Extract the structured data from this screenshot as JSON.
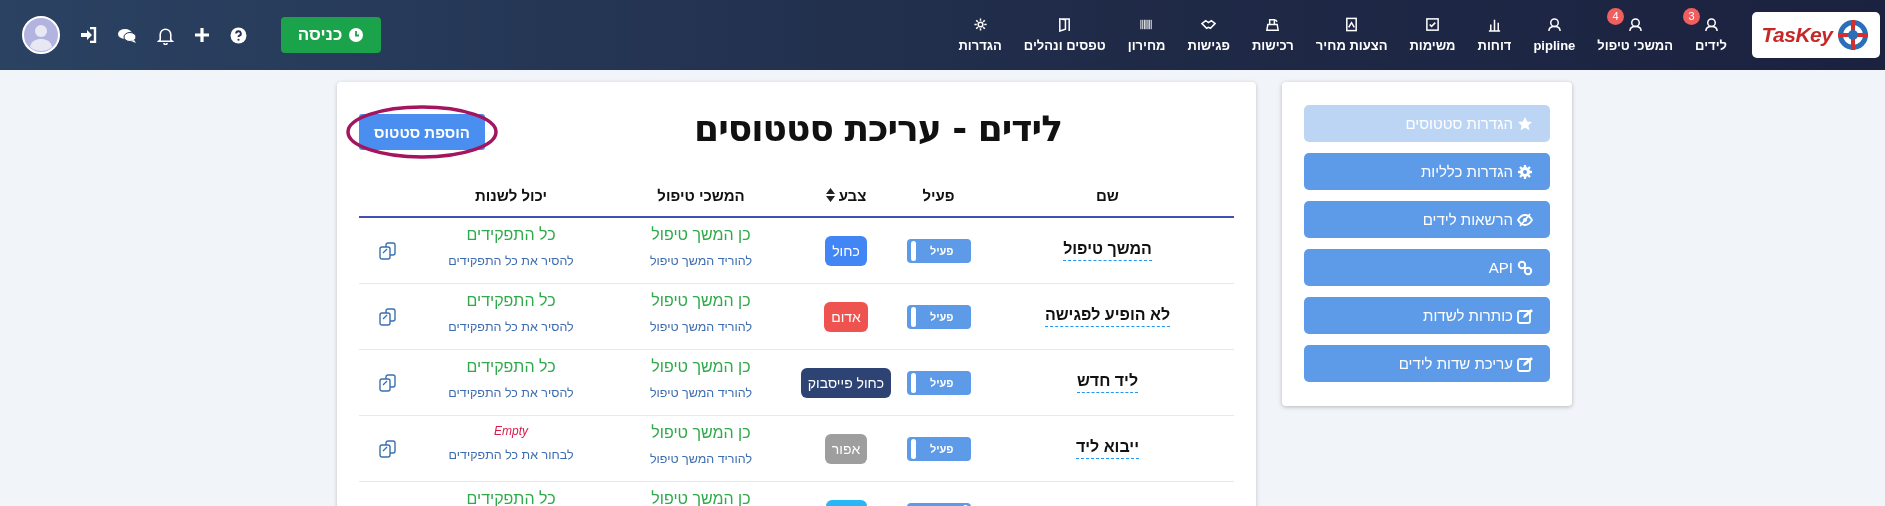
{
  "top_bar": {
    "logo": "TasKey",
    "nav_items": [
      {
        "label": "לידים",
        "badge": "3"
      },
      {
        "label": "המשכי טיפול",
        "badge": "4"
      },
      {
        "label": "pipline"
      },
      {
        "label": "דוחות"
      },
      {
        "label": "משימות"
      },
      {
        "label": "הצעות מחיר"
      },
      {
        "label": "רכישות"
      },
      {
        "label": "פגישות"
      },
      {
        "label": "מחירון"
      },
      {
        "label": "טפסים ונהלים"
      },
      {
        "label": "הגדרות"
      }
    ],
    "clock_in_button": "כניסה"
  },
  "page": {
    "title": "לידים - עריכת סטטוסים",
    "add_button": "הוספת סטטוס",
    "table": {
      "columns": [
        {
          "label": "שם",
          "sortable": false
        },
        {
          "label": "פעיל",
          "sortable": false
        },
        {
          "label": "צבע",
          "sortable": true
        },
        {
          "label": "המשכי טיפול",
          "sortable": false
        },
        {
          "label": "יכול לשנות",
          "sortable": false
        }
      ],
      "rows": [
        {
          "name": "המשך טיפול",
          "active": true,
          "active_label": "פעיל",
          "color_label": "כחול",
          "color": "#4285f4",
          "continue": "כן המשך טיפול",
          "continue_action": "להוריד המשך טיפול",
          "permissions": {
            "kind": "value",
            "text": "כל התפקידים"
          },
          "permissions_action": "להסיר את כל התפקידים"
        },
        {
          "name": "לא הופיע לפגישה",
          "active": true,
          "active_label": "פעיל",
          "color_label": "אדום",
          "color": "#ef5350",
          "continue": "כן המשך טיפול",
          "continue_action": "להוריד המשך טיפול",
          "permissions": {
            "kind": "value",
            "text": "כל התפקידים"
          },
          "permissions_action": "להסיר את כל התפקידים"
        },
        {
          "name": "ליד חדש",
          "active": true,
          "active_label": "פעיל",
          "color_label": "כחול פייסבוק",
          "color": "#2d4373",
          "continue": "כן המשך טיפול",
          "continue_action": "להוריד המשך טיפול",
          "permissions": {
            "kind": "value",
            "text": "כל התפקידים"
          },
          "permissions_action": "להסיר את כל התפקידים"
        },
        {
          "name": "ייבוא ליד",
          "active": true,
          "active_label": "פעיל",
          "color_label": "אפור",
          "color": "#9e9e9e",
          "continue": "כן המשך טיפול",
          "continue_action": "להוריד המשך טיפול",
          "permissions": {
            "kind": "empty",
            "text": "Empty"
          },
          "permissions_action": "לבחור את כל התפקידים"
        },
        {
          "active": true,
          "color": "#29b6f6",
          "continue": "כן המשך טיפול",
          "permissions": {
            "kind": "value",
            "text": "כל התפקידים"
          }
        }
      ]
    }
  },
  "sidebar": {
    "items": [
      {
        "label": "הגדרות סטטוסים",
        "selected": true
      },
      {
        "label": "הגדרות כלליות",
        "selected": false
      },
      {
        "label": "הרשאות לידים",
        "selected": false
      },
      {
        "label": "API",
        "selected": false
      },
      {
        "label": "כותרות לשדות",
        "selected": false
      },
      {
        "label": "עריכת שדות לידים",
        "selected": false
      }
    ]
  }
}
